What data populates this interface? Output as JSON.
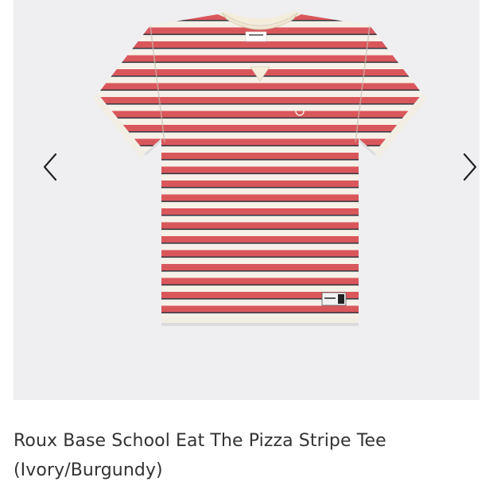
{
  "product": {
    "name_line1": "Roux Base School Eat The Pizza Stripe Tee",
    "name_line2": "(Ivory/Burgundy)"
  },
  "gallery": {
    "prev_icon": "chevron-left-icon",
    "next_icon": "chevron-right-icon",
    "image": "striped-t-shirt-photo",
    "colors": {
      "background": "#efeff1",
      "ivory": "#f6f1e8",
      "stripe": "#d9575b",
      "stripe_dark": "#3a3a44"
    }
  }
}
